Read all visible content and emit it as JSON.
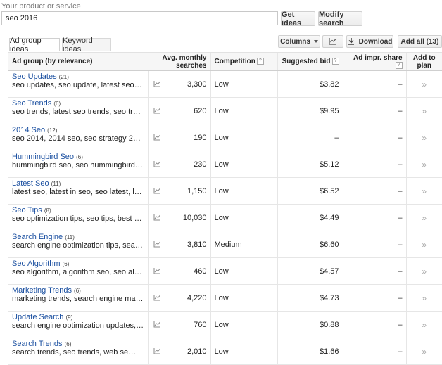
{
  "search": {
    "label": "Your product or service",
    "value": "seo 2016",
    "get_ideas": "Get ideas",
    "modify_search": "Modify search"
  },
  "tabs": [
    {
      "label": "Ad group ideas",
      "active": true
    },
    {
      "label": "Keyword ideas",
      "active": false
    }
  ],
  "toolbar": {
    "columns": "Columns",
    "download": "Download",
    "add_all": "Add all (13)"
  },
  "headers": {
    "ad_group": "Ad group (by relevance)",
    "searches": "Avg. monthly searches",
    "competition": "Competition",
    "suggested_bid": "Suggested bid",
    "impr_share": "Ad impr. share",
    "add_to_plan": "Add to plan",
    "help_glyph": "?"
  },
  "rows": [
    {
      "name": "Seo Updates",
      "count": "(21)",
      "keywords": "seo updates, seo update, latest seo updates…",
      "searches": "3,300",
      "competition": "Low",
      "bid": "$3.82",
      "share": "–"
    },
    {
      "name": "Seo Trends",
      "count": "(6)",
      "keywords": "seo trends, latest seo trends, seo trend, late…",
      "searches": "620",
      "competition": "Low",
      "bid": "$9.95",
      "share": "–"
    },
    {
      "name": "2014 Seo",
      "count": "(12)",
      "keywords": "seo 2014, 2014 seo, seo strategy 2014, best…",
      "searches": "190",
      "competition": "Low",
      "bid": "–",
      "share": "–"
    },
    {
      "name": "Hummingbird Seo",
      "count": "(6)",
      "keywords": "hummingbird seo, seo hummingbird, hummin…",
      "searches": "230",
      "competition": "Low",
      "bid": "$5.12",
      "share": "–"
    },
    {
      "name": "Latest Seo",
      "count": "(11)",
      "keywords": "latest seo, latest in seo, seo latest, latest se…",
      "searches": "1,150",
      "competition": "Low",
      "bid": "$6.52",
      "share": "–"
    },
    {
      "name": "Seo Tips",
      "count": "(8)",
      "keywords": "seo optimization tips, seo tips, best seo tips…",
      "searches": "10,030",
      "competition": "Low",
      "bid": "$4.49",
      "share": "–"
    },
    {
      "name": "Search Engine",
      "count": "(11)",
      "keywords": "search engine optimization tips, search engi…",
      "searches": "3,810",
      "competition": "Medium",
      "bid": "$6.60",
      "share": "–"
    },
    {
      "name": "Seo Algorithm",
      "count": "(6)",
      "keywords": "seo algorithm, algorithm seo, seo algorithms…",
      "searches": "460",
      "competition": "Low",
      "bid": "$4.57",
      "share": "–"
    },
    {
      "name": "Marketing Trends",
      "count": "(6)",
      "keywords": "marketing trends, search engine marketing tr…",
      "searches": "4,220",
      "competition": "Low",
      "bid": "$4.73",
      "share": "–"
    },
    {
      "name": "Update Search",
      "count": "(9)",
      "keywords": "search engine optimization updates, search …",
      "searches": "760",
      "competition": "Low",
      "bid": "$0.88",
      "share": "–"
    },
    {
      "name": "Search Trends",
      "count": "(6)",
      "keywords": "search trends, seo trends, web se…",
      "searches": "2,010",
      "competition": "Low",
      "bid": "$1.66",
      "share": "–"
    }
  ],
  "icons": {
    "trend": "line-chart-icon",
    "add": "double-chevron-right-icon",
    "download": "download-icon"
  },
  "colors": {
    "link": "#1a4fa0"
  }
}
